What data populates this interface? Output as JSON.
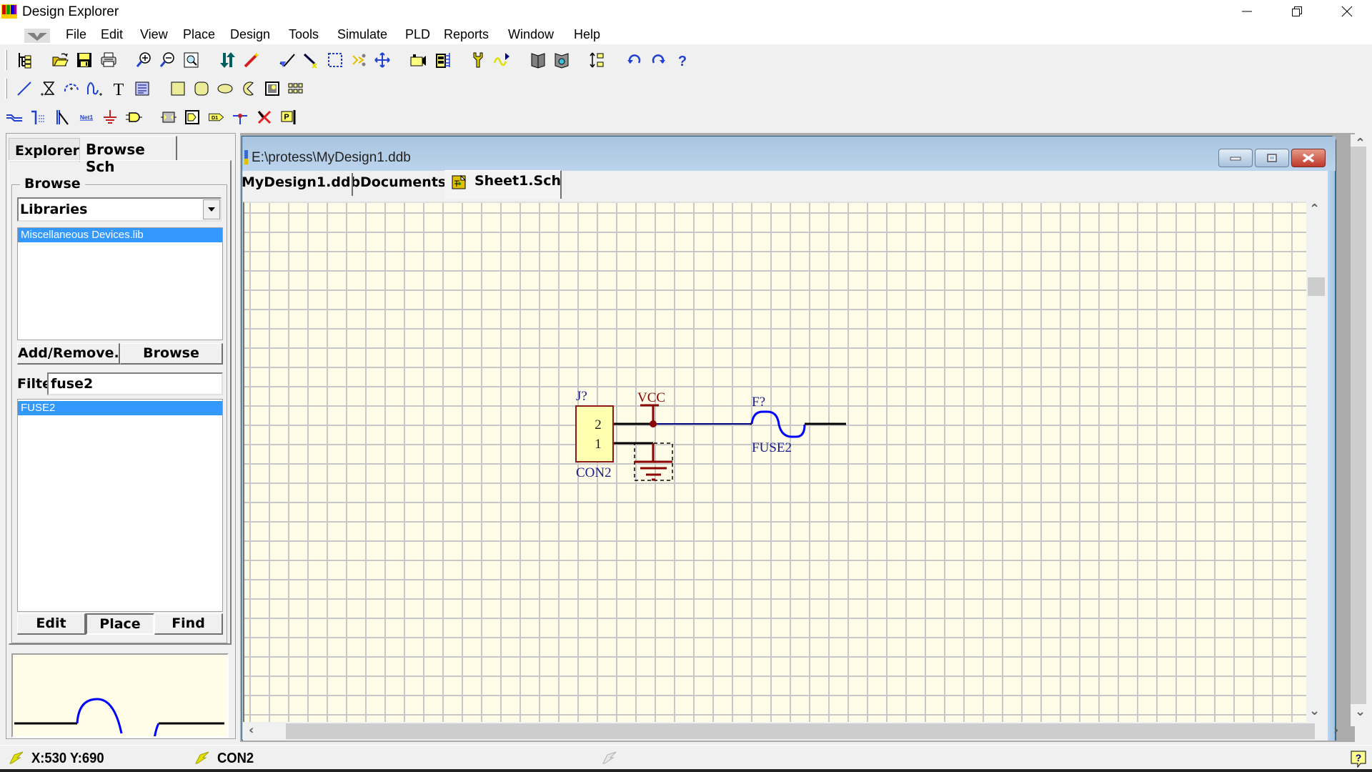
{
  "window": {
    "title": "Design Explorer",
    "controls": {
      "minimize": "minimize",
      "restore": "restore",
      "close": "close"
    }
  },
  "menubar": {
    "items": [
      {
        "label": "File"
      },
      {
        "label": "Edit"
      },
      {
        "label": "View"
      },
      {
        "label": "Place"
      },
      {
        "label": "Design"
      },
      {
        "label": "Tools"
      },
      {
        "label": "Simulate"
      },
      {
        "label": "PLD"
      },
      {
        "label": "Reports"
      },
      {
        "label": "Window"
      },
      {
        "label": "Help"
      }
    ]
  },
  "toolbars": {
    "main": [
      "design-manager",
      "open",
      "save",
      "print",
      "zoom-in",
      "zoom-out",
      "zoom-fit",
      "cross-probe",
      "browse-sheets",
      "wiring-tools",
      "move-selection",
      "select-area",
      "deselect",
      "move-cross",
      "digital-objects",
      "place-part",
      "probe",
      "simulate",
      "edit-library",
      "browse-library",
      "increment-parts",
      "undo",
      "redo",
      "help"
    ],
    "drawing": [
      "line",
      "polygon",
      "arc",
      "bezier",
      "text",
      "text-frame",
      "rectangle",
      "round-rectangle",
      "ellipse",
      "pie",
      "graphic",
      "array"
    ],
    "wiring": [
      "wire",
      "bus",
      "bus-entry",
      "net-label",
      "power-port",
      "part",
      "sheet-symbol",
      "sheet-entry",
      "port",
      "junction",
      "no-erc",
      "pcb-layout"
    ],
    "net_label_text": "Net1",
    "port_text": "D1",
    "pcb_text": "P"
  },
  "left_panel": {
    "tabs": [
      {
        "label": "Explorer",
        "active": false
      },
      {
        "label": "Browse Sch",
        "active": true
      }
    ],
    "browse_group_label": "Browse",
    "browse_select_value": "Libraries",
    "libraries": [
      {
        "name": "Miscellaneous Devices.lib",
        "selected": true
      }
    ],
    "add_remove_label": "Add/Remove...",
    "browse_button_label": "Browse",
    "filter_label": "Filte",
    "filter_value": "fuse2",
    "components": [
      {
        "name": "FUSE2",
        "selected": true
      }
    ],
    "edit_label": "Edit",
    "place_label": "Place",
    "find_label": "Find"
  },
  "document": {
    "title": "E:\\protess\\MyDesign1.ddb",
    "tabs": [
      {
        "label": "MyDesign1.ddb",
        "active": false
      },
      {
        "label": "Documents",
        "active": false
      },
      {
        "label": "Sheet1.Sch",
        "active": true
      }
    ],
    "schematic": {
      "connector": {
        "designator": "J?",
        "comment": "CON2",
        "pins": [
          "2",
          "1"
        ]
      },
      "power_port": {
        "label": "VCC"
      },
      "fuse": {
        "designator": "F?",
        "comment": "FUSE2"
      }
    }
  },
  "statusbar": {
    "coordinates": "X:530 Y:690",
    "current_part": "CON2"
  },
  "colors": {
    "sheet_bg": "#fffde8",
    "grid": "#c8c8c8",
    "component_fill": "#ffffb0",
    "component_border": "#8b1a1a",
    "label_blue": "#1a1a8b",
    "power_red": "#8b0000",
    "wire_blue": "#000080",
    "selection_blue": "#3399ff"
  }
}
